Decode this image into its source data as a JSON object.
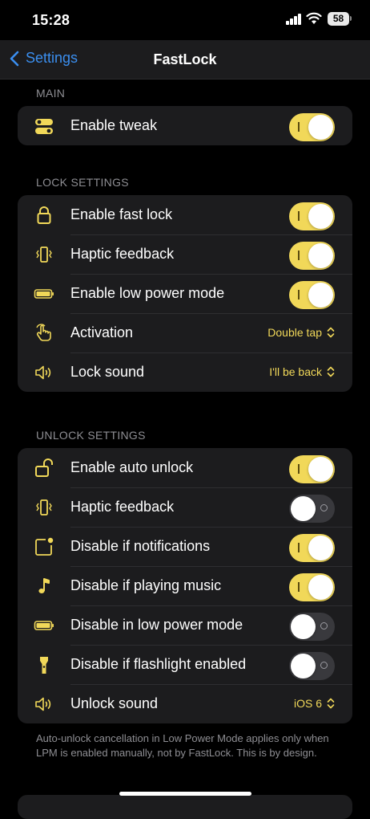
{
  "status_bar": {
    "time": "15:28",
    "battery": "58"
  },
  "nav": {
    "back_label": "Settings",
    "title": "FastLock"
  },
  "sections": {
    "main": {
      "header": "MAIN",
      "rows": [
        {
          "label": "Enable tweak",
          "icon": "toggles-icon",
          "control": "toggle",
          "on": true
        }
      ]
    },
    "lock": {
      "header": "LOCK SETTINGS",
      "rows": [
        {
          "label": "Enable fast lock",
          "icon": "lock-icon",
          "control": "toggle",
          "on": true
        },
        {
          "label": "Haptic feedback",
          "icon": "vibration-icon",
          "control": "toggle",
          "on": true
        },
        {
          "label": "Enable low power mode",
          "icon": "battery-icon",
          "control": "toggle",
          "on": true
        },
        {
          "label": "Activation",
          "icon": "hand-tap-icon",
          "control": "select",
          "value": "Double tap"
        },
        {
          "label": "Lock sound",
          "icon": "speaker-icon",
          "control": "select",
          "value": "I'll be back"
        }
      ]
    },
    "unlock": {
      "header": "UNLOCK SETTINGS",
      "rows": [
        {
          "label": "Enable auto unlock",
          "icon": "unlock-icon",
          "control": "toggle",
          "on": true
        },
        {
          "label": "Haptic feedback",
          "icon": "vibration-icon",
          "control": "toggle",
          "on": false
        },
        {
          "label": "Disable if notifications",
          "icon": "notification-badge-icon",
          "control": "toggle",
          "on": true
        },
        {
          "label": "Disable if playing music",
          "icon": "music-note-icon",
          "control": "toggle",
          "on": true
        },
        {
          "label": "Disable in low power mode",
          "icon": "battery-icon",
          "control": "toggle",
          "on": false
        },
        {
          "label": "Disable if flashlight enabled",
          "icon": "flashlight-icon",
          "control": "toggle",
          "on": false
        },
        {
          "label": "Unlock sound",
          "icon": "speaker-icon",
          "control": "select",
          "value": "iOS 6"
        }
      ],
      "footer": "Auto-unlock cancellation in Low Power Mode applies only when LPM is enabled manually, not by FastLock. This is by design."
    }
  },
  "colors": {
    "accent": "#f1d859",
    "link": "#3b8ff0",
    "cell": "#1c1c1e",
    "secondary_text": "#8e8e93"
  }
}
